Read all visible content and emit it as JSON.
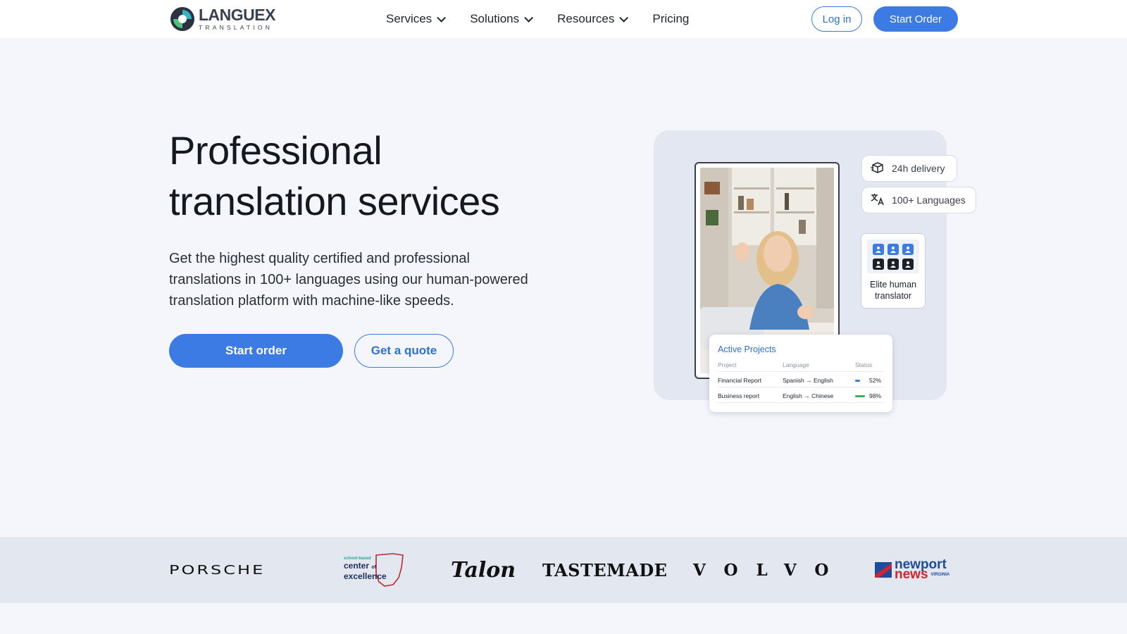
{
  "nav": {
    "logo_name": "LANGUEX",
    "logo_sub": "TRANSLATION",
    "links": [
      {
        "label": "Services",
        "has_dropdown": true
      },
      {
        "label": "Solutions",
        "has_dropdown": true
      },
      {
        "label": "Resources",
        "has_dropdown": true
      },
      {
        "label": "Pricing",
        "has_dropdown": false
      }
    ],
    "login_label": "Log in",
    "start_label": "Start Order"
  },
  "hero": {
    "title_line1": "Professional",
    "title_line2": "translation services",
    "subtitle": "Get the highest quality certified and professional translations in 100+ languages using our human-powered translation platform with machine-like speeds.",
    "primary_cta": "Start order",
    "secondary_cta": "Get a quote"
  },
  "illustration": {
    "chip_delivery": "24h delivery",
    "chip_languages": "100+ Languages",
    "elite_label": "Elite human translator",
    "projects": {
      "title": "Active Projects",
      "headers": [
        "Project",
        "Language",
        "Status"
      ],
      "rows": [
        {
          "project": "Financial Report",
          "language": "Spanish → English",
          "status": "52%",
          "progress": 0.52,
          "color": "#3c7be3"
        },
        {
          "project": "Business report",
          "language": "English → Chinese",
          "status": "98%",
          "progress": 0.98,
          "color": "#3fae5a"
        }
      ]
    }
  },
  "logos": {
    "porsche": "PORSCHE",
    "center_small": "school-based",
    "center_main1": "center",
    "center_of": "of",
    "center_main2": "excellence",
    "talon": "Talon",
    "tastemade": "TASTEMADE",
    "volvo": "VOLVO",
    "newport1": "newport",
    "newport2": "news",
    "newport_state": "VIRGINIA"
  },
  "colors": {
    "accent": "#3c7be3",
    "background": "#f4f6fb",
    "strip": "#e2e7f0"
  }
}
